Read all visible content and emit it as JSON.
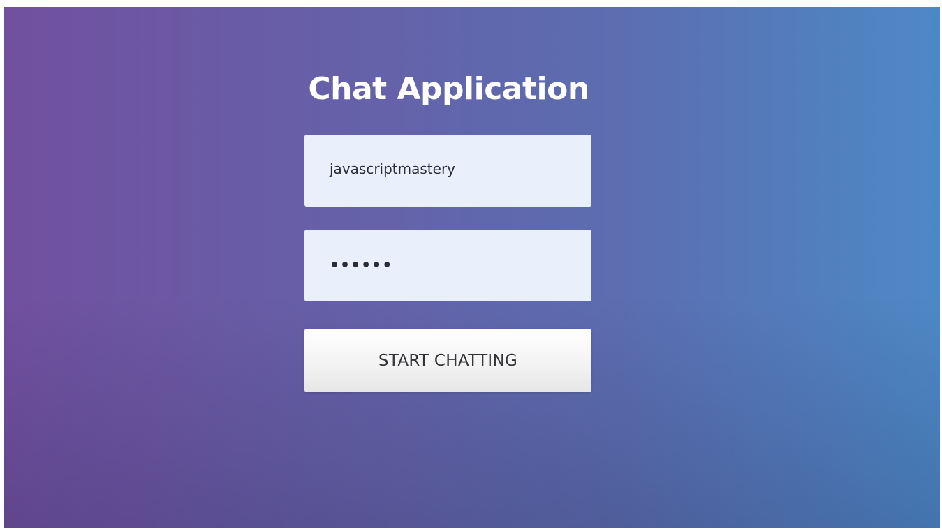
{
  "app": {
    "title": "Chat Application"
  },
  "form": {
    "username_value": "javascriptmastery",
    "password_display": "••••••",
    "submit_label": "START CHATTING"
  },
  "colors": {
    "gradient_left": "#7150a0",
    "gradient_right": "#4d89c6",
    "input_bg": "#e9effb",
    "button_bg": "#f2f2f2",
    "title_text": "#ffffff"
  }
}
